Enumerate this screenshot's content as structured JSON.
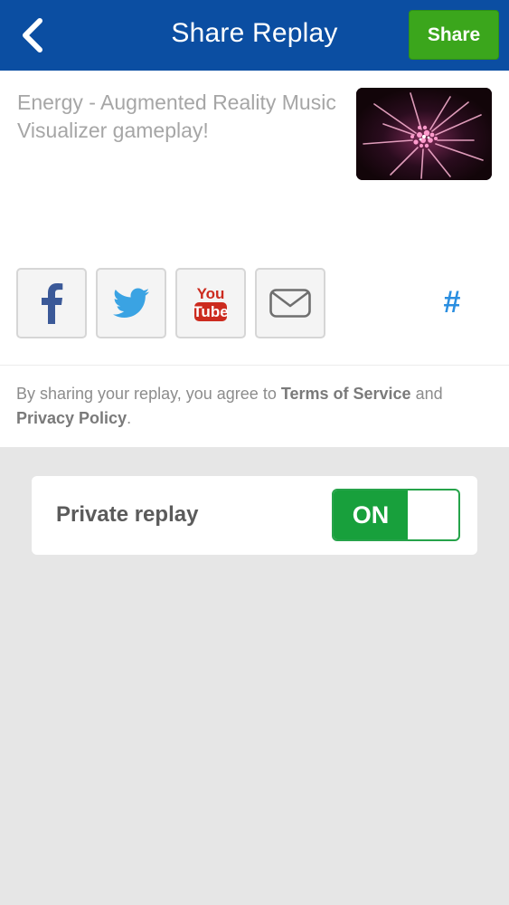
{
  "navbar": {
    "title": "Share Replay",
    "share_label": "Share",
    "back_icon": "chevron-left-icon",
    "bg_color": "#0b4ea2",
    "share_color": "#3ba61c"
  },
  "compose": {
    "description": "Energy - Augmented Reality Music Visualizer gameplay!",
    "thumbnail": "gameplay-thumbnail"
  },
  "social": {
    "buttons": [
      {
        "name": "facebook",
        "icon": "facebook-icon"
      },
      {
        "name": "twitter",
        "icon": "twitter-icon"
      },
      {
        "name": "youtube",
        "icon": "youtube-icon",
        "line1": "You",
        "line2": "Tube"
      },
      {
        "name": "email",
        "icon": "envelope-icon"
      }
    ],
    "hashtag": "#"
  },
  "terms": {
    "prefix": "By sharing your replay, you agree to ",
    "tos": "Terms of Service",
    "and": " and ",
    "privacy": "Privacy Policy",
    "suffix": "."
  },
  "private": {
    "label": "Private replay",
    "toggle_text": "ON",
    "toggle_state": true,
    "toggle_color": "#18a03c"
  }
}
